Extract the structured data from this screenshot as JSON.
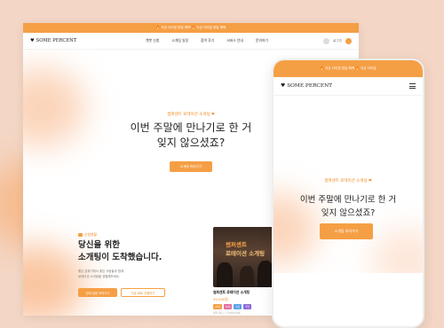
{
  "promo_text": "🔥 지금 다이얼 한달 혜택 🔥 지금 다이얼 한달 혜택",
  "brand": "SOME PERCENT",
  "nav": [
    "챗봇 신청",
    "소개팅 일정",
    "참여 후기",
    "서비스 안내",
    "문의하기"
  ],
  "login_label": "로그인",
  "hero": {
    "tagline": "썸퍼센트 로테이션 소개팅 ❤",
    "title_line1": "이번 주말에 만나기로 한 거",
    "title_line2": "잊지 않으셨죠?",
    "cta": "소개팅 하러가기"
  },
  "section2": {
    "badge": "신청현황",
    "title_line1": "당신을 위한",
    "title_line2": "소개팅이 도착했습니다.",
    "desc_line1": "좋은 분위기에서 좋은 사람들과 함께",
    "desc_line2": "로테이션 소개팅을 경험해보세요.",
    "btn_primary": "전체 일정 보러가기",
    "btn_outline": "지금 바로 신청하기"
  },
  "card": {
    "image_text_line1": "썸퍼센트",
    "image_text_line2": "로테이션 소개팅",
    "title": "썸퍼센트 로테이션 소개팅",
    "price": "39,000원",
    "tags": [
      "20대",
      "30대",
      "강남",
      "주말"
    ],
    "meta": "서울 강남구 · 남 0명 여 0명"
  },
  "mobile": {
    "promo_text": "🔥 지금 다이얼 한달 혜택 🔥 지금 다이얼",
    "tagline": "썸퍼센트 로테이션 소개팅 ❤",
    "title_line1": "이번 주말에 만나기로 한 거",
    "title_line2": "잊지 않으셨죠?",
    "cta": "소개팅 하러가기"
  },
  "colors": {
    "accent": "#f59f45",
    "accent_text": "#f08a23",
    "background": "#f3d6c5"
  }
}
